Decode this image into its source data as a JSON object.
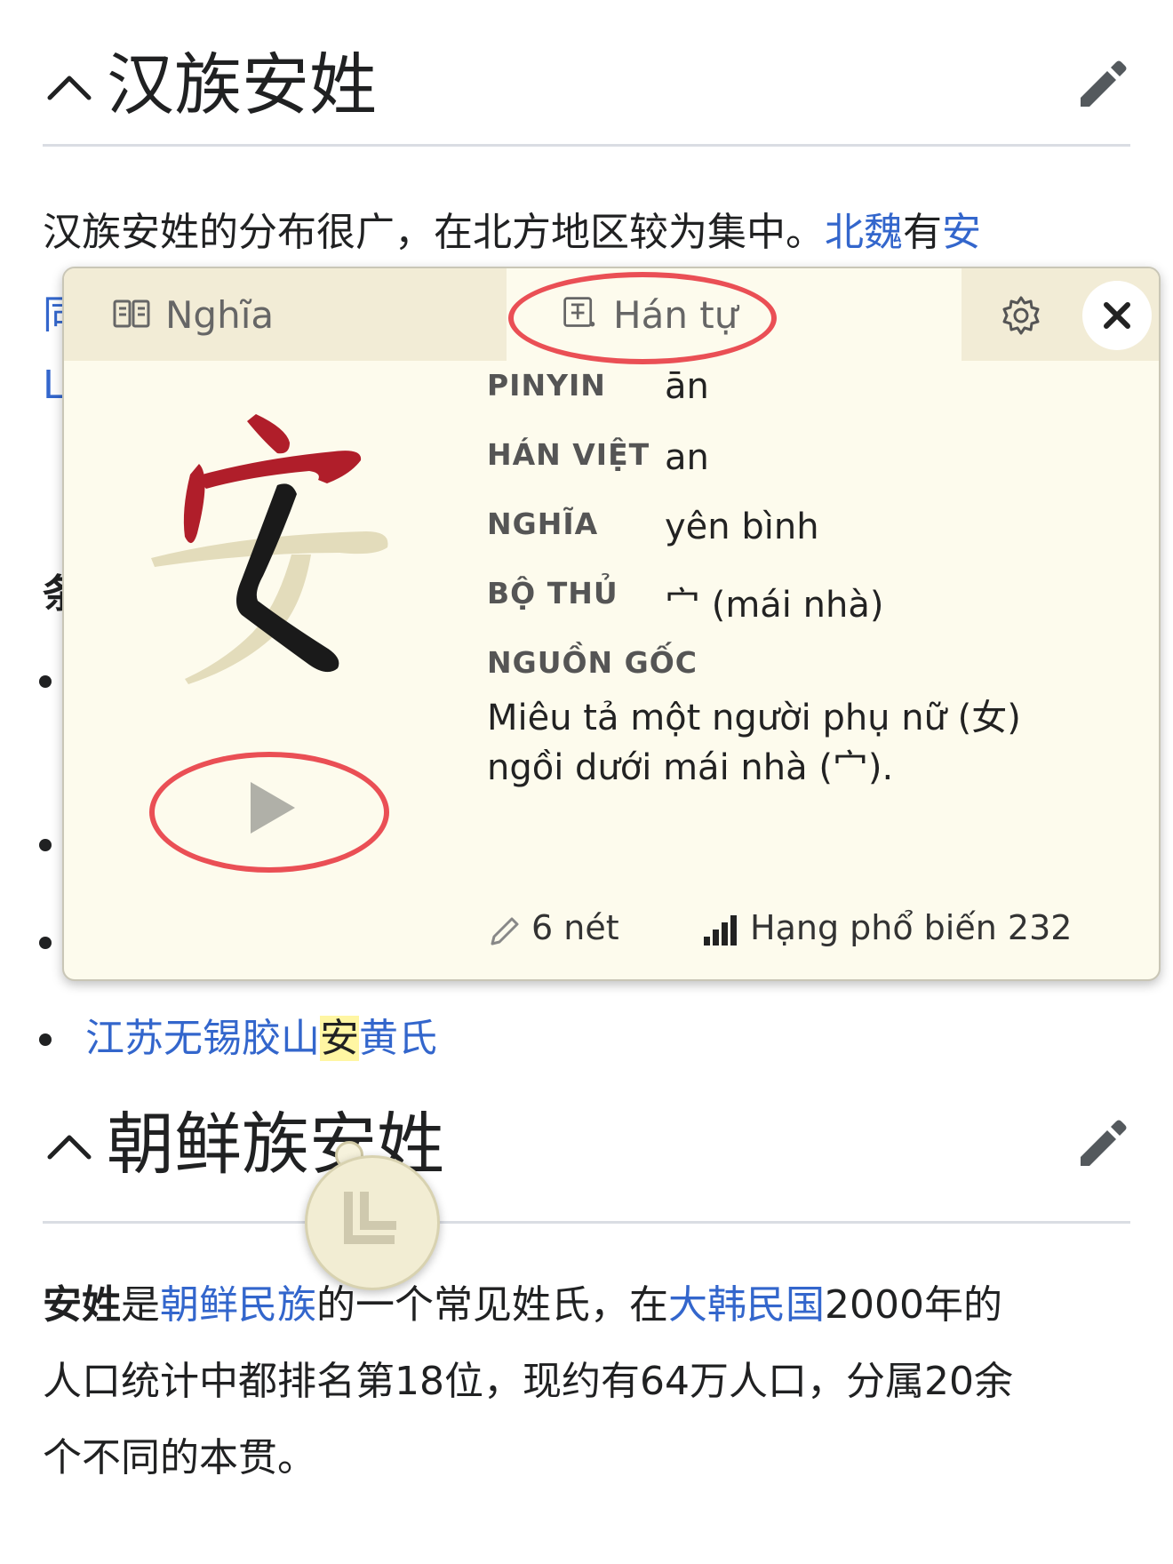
{
  "section1": {
    "title": "汉族安姓",
    "para_black": "汉族安姓的分布很广，在北方地区较为集中。",
    "para_link1": "北魏",
    "para_mid": "有",
    "para_link2": "安",
    "stray_fragments": [
      "同",
      "L",
      "条"
    ]
  },
  "bullet_item": {
    "pre": "江苏无锡胶山",
    "highlight": "安",
    "post": "黄氏"
  },
  "section2": {
    "title": "朝鲜族安姓",
    "bold": "安姓",
    "t1": "是",
    "link1": "朝鲜民族",
    "t2": "的一个常见姓氏，在",
    "link2": "大韩民国",
    "t3": "2000年的",
    "line2": "人口统计中都排名第18位，现约有64万人口，分属20余",
    "line3": "个不同的本贯。"
  },
  "popup": {
    "tabs": {
      "meaning": {
        "label": "Nghĩa",
        "icon": "book-icon"
      },
      "hanzi": {
        "label": "Hán tự",
        "icon": "character-card-icon",
        "active": true
      }
    },
    "character": "安",
    "rows": [
      {
        "label": "PINYIN",
        "value": "ān"
      },
      {
        "label": "HÁN VIỆT",
        "value": "an"
      },
      {
        "label": "NGHĨA",
        "value": "yên bình"
      },
      {
        "label": "BỘ THỦ",
        "value": "宀 (mái nhà)"
      }
    ],
    "origin_label": "NGUỒN GỐC",
    "origin_text": "Miêu tả một người phụ nữ (女) ngồi dưới mái nhà (宀).",
    "strokes": "6 nét",
    "rank": "Hạng phổ biến 232"
  },
  "colors": {
    "link": "#3366cc",
    "popup_bg": "#fdfbed",
    "tab_inactive_bg": "#f2ecd6",
    "annotation_red": "#ea4f55",
    "stroke_red": "#b01e2a",
    "stroke_black": "#1a1a1a",
    "stroke_pending": "#e3dcbb"
  }
}
